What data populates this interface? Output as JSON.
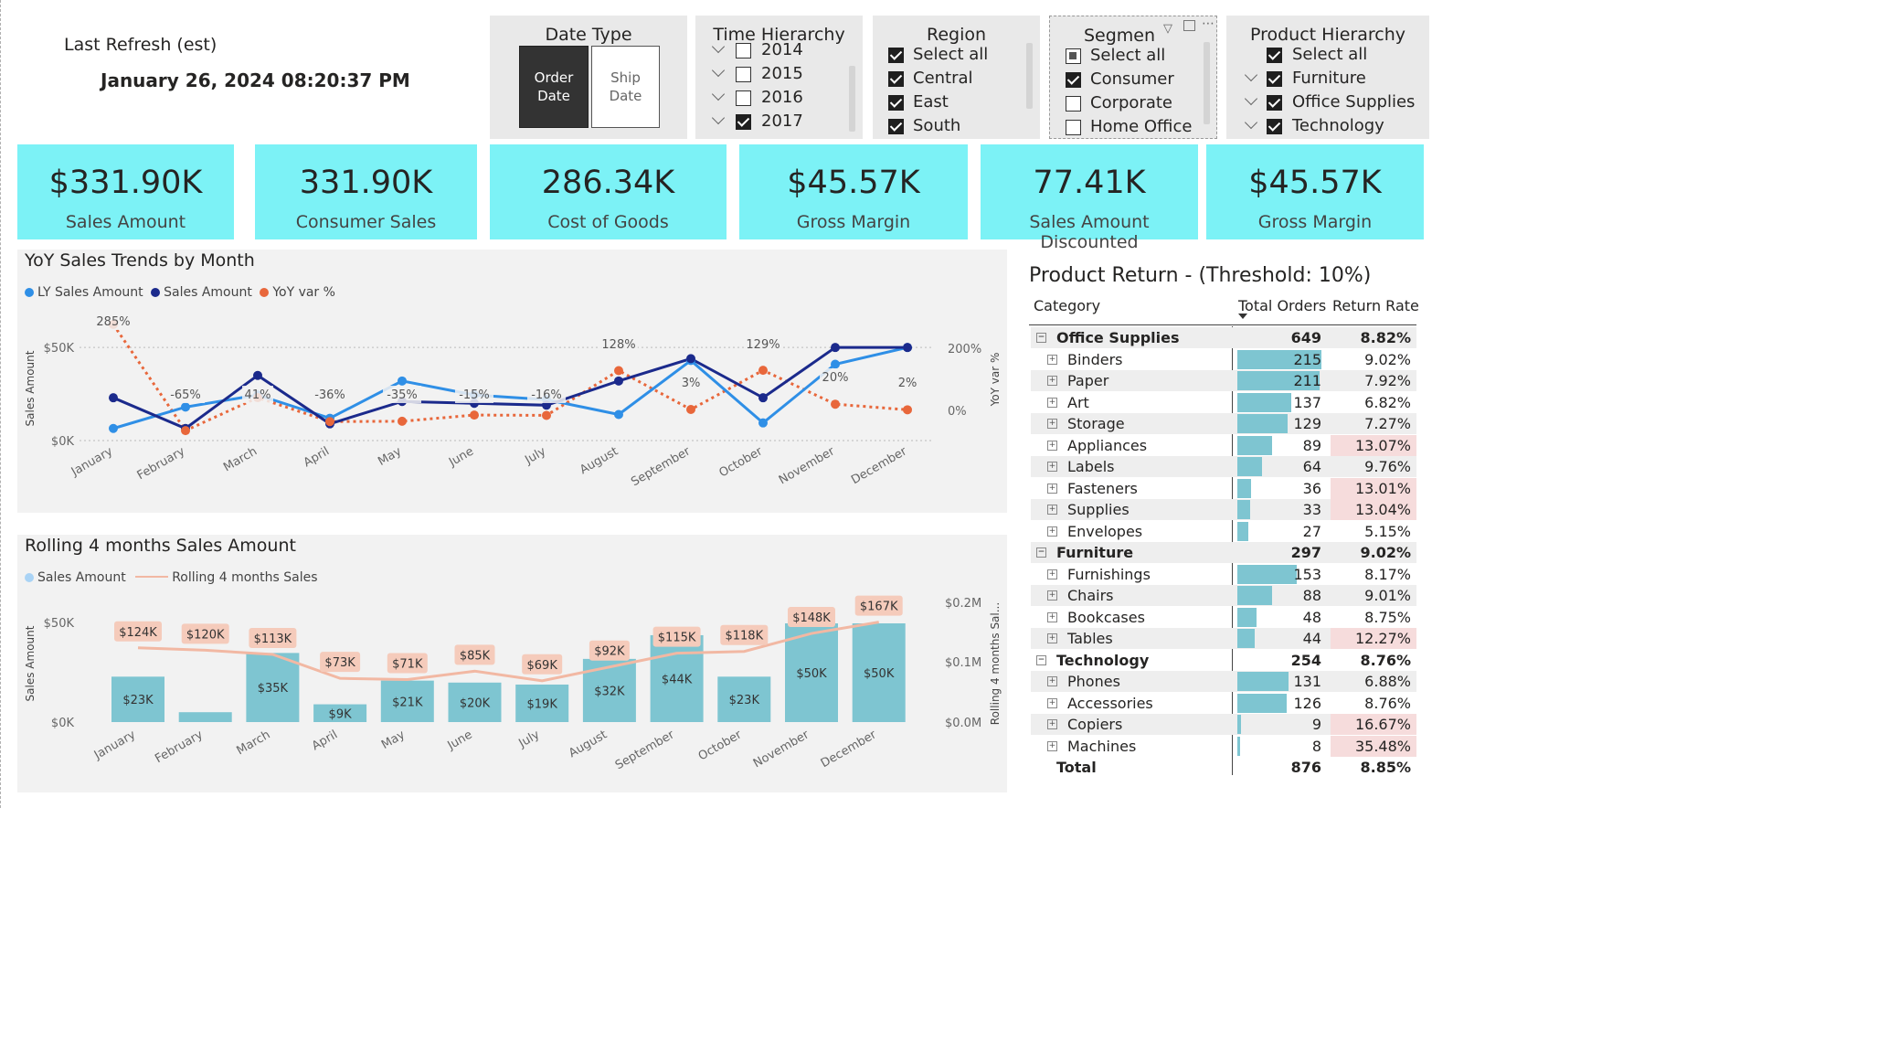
{
  "refresh": {
    "label": "Last Refresh (est)",
    "timestamp": "January 26, 2024 08:20:37 PM"
  },
  "date_type": {
    "title": "Date Type",
    "options": [
      "Order Date",
      "Ship Date"
    ],
    "selected": "Order Date"
  },
  "time_hierarchy": {
    "title": "Time Hierarchy",
    "items": [
      {
        "label": "2014",
        "checked": false
      },
      {
        "label": "2015",
        "checked": false
      },
      {
        "label": "2016",
        "checked": false
      },
      {
        "label": "2017",
        "checked": true
      }
    ]
  },
  "region": {
    "title": "Region",
    "items": [
      {
        "label": "Select all",
        "checked": true
      },
      {
        "label": "Central",
        "checked": true
      },
      {
        "label": "East",
        "checked": true
      },
      {
        "label": "South",
        "checked": true
      }
    ]
  },
  "segment": {
    "title": "Segmen",
    "items": [
      {
        "label": "Select all",
        "state": "partial"
      },
      {
        "label": "Consumer",
        "state": "on"
      },
      {
        "label": "Corporate",
        "state": "off"
      },
      {
        "label": "Home Office",
        "state": "off"
      }
    ]
  },
  "product_hierarchy": {
    "title": "Product Hierarchy",
    "items": [
      {
        "label": "Select all",
        "checked": true,
        "chevron": false
      },
      {
        "label": "Furniture",
        "checked": true,
        "chevron": true
      },
      {
        "label": "Office Supplies",
        "checked": true,
        "chevron": true
      },
      {
        "label": "Technology",
        "checked": true,
        "chevron": true
      }
    ]
  },
  "kpis": [
    {
      "value": "$331.90K",
      "label": "Sales Amount"
    },
    {
      "value": "331.90K",
      "label": "Consumer Sales"
    },
    {
      "value": "286.34K",
      "label": "Cost of Goods"
    },
    {
      "value": "$45.57K",
      "label": "Gross Margin"
    },
    {
      "value": "77.41K",
      "label": "Sales Amount Discounted"
    },
    {
      "value": "$45.57K",
      "label": "Gross Margin"
    }
  ],
  "colors": {
    "kpi_bg": "#7cf2f6",
    "ly_sales": "#2f8fe6",
    "sales": "#1b2a8c",
    "yoy": "#e8673b",
    "bar": "#7ec5d1",
    "rolling": "#f2b8a3",
    "alert": "#f6dcdc"
  },
  "chart_data": [
    {
      "type": "line",
      "title": "YoY Sales Trends by Month",
      "ylabel": "Sales Amount",
      "y2label": "YoY var %",
      "categories": [
        "January",
        "February",
        "March",
        "April",
        "May",
        "June",
        "July",
        "August",
        "September",
        "October",
        "November",
        "December"
      ],
      "y_ticks": [
        "$0K",
        "$50K"
      ],
      "y2_ticks": [
        "0%",
        "200%"
      ],
      "ylim": [
        0,
        55000
      ],
      "y2lim": [
        -80,
        260
      ],
      "series": [
        {
          "name": "LY Sales Amount",
          "values": [
            6500,
            18000,
            24500,
            12000,
            32000,
            24500,
            22000,
            14000,
            43000,
            9500,
            41000,
            50000
          ]
        },
        {
          "name": "Sales Amount",
          "values": [
            23000,
            6500,
            35000,
            9000,
            21000,
            20000,
            19000,
            32000,
            44000,
            23000,
            50000,
            50000
          ]
        },
        {
          "name": "YoY var %",
          "values": [
            285,
            -65,
            41,
            -36,
            -35,
            -15,
            -16,
            128,
            3,
            129,
            20,
            2
          ],
          "labels": [
            "285%",
            "-65%",
            "41%",
            "-36%",
            "-35%",
            "-15%",
            "-16%",
            "128%",
            "3%",
            "129%",
            "20%",
            "2%"
          ]
        }
      ]
    },
    {
      "type": "bar",
      "title": "Rolling 4 months Sales Amount",
      "ylabel": "Sales Amount",
      "y2label": "Rolling 4 months Sal...",
      "categories": [
        "January",
        "February",
        "March",
        "April",
        "May",
        "June",
        "July",
        "August",
        "September",
        "October",
        "November",
        "December"
      ],
      "y_ticks": [
        "$0K",
        "$50K"
      ],
      "y2_ticks": [
        "$0.0M",
        "$0.1M",
        "$0.2M"
      ],
      "ylim": [
        0,
        55000
      ],
      "y2lim": [
        0,
        200000
      ],
      "series": [
        {
          "name": "Sales Amount",
          "values": [
            23000,
            5000,
            35000,
            9000,
            21000,
            20000,
            19000,
            32000,
            44000,
            23000,
            50000,
            50000
          ],
          "labels": [
            "$23K",
            "",
            "$35K",
            "$9K",
            "$21K",
            "$20K",
            "$19K",
            "$32K",
            "$44K",
            "$23K",
            "$50K",
            "$50K"
          ]
        },
        {
          "name": "Rolling 4 months Sales",
          "values": [
            124000,
            120000,
            113000,
            73000,
            71000,
            85000,
            69000,
            92000,
            115000,
            118000,
            148000,
            167000
          ],
          "labels": [
            "$124K",
            "$120K",
            "$113K",
            "$73K",
            "$71K",
            "$85K",
            "$69K",
            "$92K",
            "$115K",
            "$118K",
            "$148K",
            "$167K"
          ]
        }
      ]
    }
  ],
  "product_return": {
    "title": "Product Return - (Threshold: 10%)",
    "headers": {
      "category": "Category",
      "orders": "Total Orders",
      "rate": "Return Rate"
    },
    "max_orders": 215,
    "rows": [
      {
        "level": 0,
        "name": "Office Supplies",
        "orders": "649",
        "rate": "8.82%",
        "n": 649,
        "alert": false
      },
      {
        "level": 1,
        "name": "Binders",
        "orders": "215",
        "rate": "9.02%",
        "n": 215,
        "alert": false
      },
      {
        "level": 1,
        "name": "Paper",
        "orders": "211",
        "rate": "7.92%",
        "n": 211,
        "alert": false
      },
      {
        "level": 1,
        "name": "Art",
        "orders": "137",
        "rate": "6.82%",
        "n": 137,
        "alert": false
      },
      {
        "level": 1,
        "name": "Storage",
        "orders": "129",
        "rate": "7.27%",
        "n": 129,
        "alert": false
      },
      {
        "level": 1,
        "name": "Appliances",
        "orders": "89",
        "rate": "13.07%",
        "n": 89,
        "alert": true
      },
      {
        "level": 1,
        "name": "Labels",
        "orders": "64",
        "rate": "9.76%",
        "n": 64,
        "alert": false
      },
      {
        "level": 1,
        "name": "Fasteners",
        "orders": "36",
        "rate": "13.01%",
        "n": 36,
        "alert": true
      },
      {
        "level": 1,
        "name": "Supplies",
        "orders": "33",
        "rate": "13.04%",
        "n": 33,
        "alert": true
      },
      {
        "level": 1,
        "name": "Envelopes",
        "orders": "27",
        "rate": "5.15%",
        "n": 27,
        "alert": false
      },
      {
        "level": 0,
        "name": "Furniture",
        "orders": "297",
        "rate": "9.02%",
        "n": 297,
        "alert": false
      },
      {
        "level": 1,
        "name": "Furnishings",
        "orders": "153",
        "rate": "8.17%",
        "n": 153,
        "alert": false
      },
      {
        "level": 1,
        "name": "Chairs",
        "orders": "88",
        "rate": "9.01%",
        "n": 88,
        "alert": false
      },
      {
        "level": 1,
        "name": "Bookcases",
        "orders": "48",
        "rate": "8.75%",
        "n": 48,
        "alert": false
      },
      {
        "level": 1,
        "name": "Tables",
        "orders": "44",
        "rate": "12.27%",
        "n": 44,
        "alert": true
      },
      {
        "level": 0,
        "name": "Technology",
        "orders": "254",
        "rate": "8.76%",
        "n": 254,
        "alert": false
      },
      {
        "level": 1,
        "name": "Phones",
        "orders": "131",
        "rate": "6.88%",
        "n": 131,
        "alert": false
      },
      {
        "level": 1,
        "name": "Accessories",
        "orders": "126",
        "rate": "8.76%",
        "n": 126,
        "alert": false
      },
      {
        "level": 1,
        "name": "Copiers",
        "orders": "9",
        "rate": "16.67%",
        "n": 9,
        "alert": true
      },
      {
        "level": 1,
        "name": "Machines",
        "orders": "8",
        "rate": "35.48%",
        "n": 8,
        "alert": true
      }
    ],
    "total": {
      "name": "Total",
      "orders": "876",
      "rate": "8.85%"
    }
  }
}
